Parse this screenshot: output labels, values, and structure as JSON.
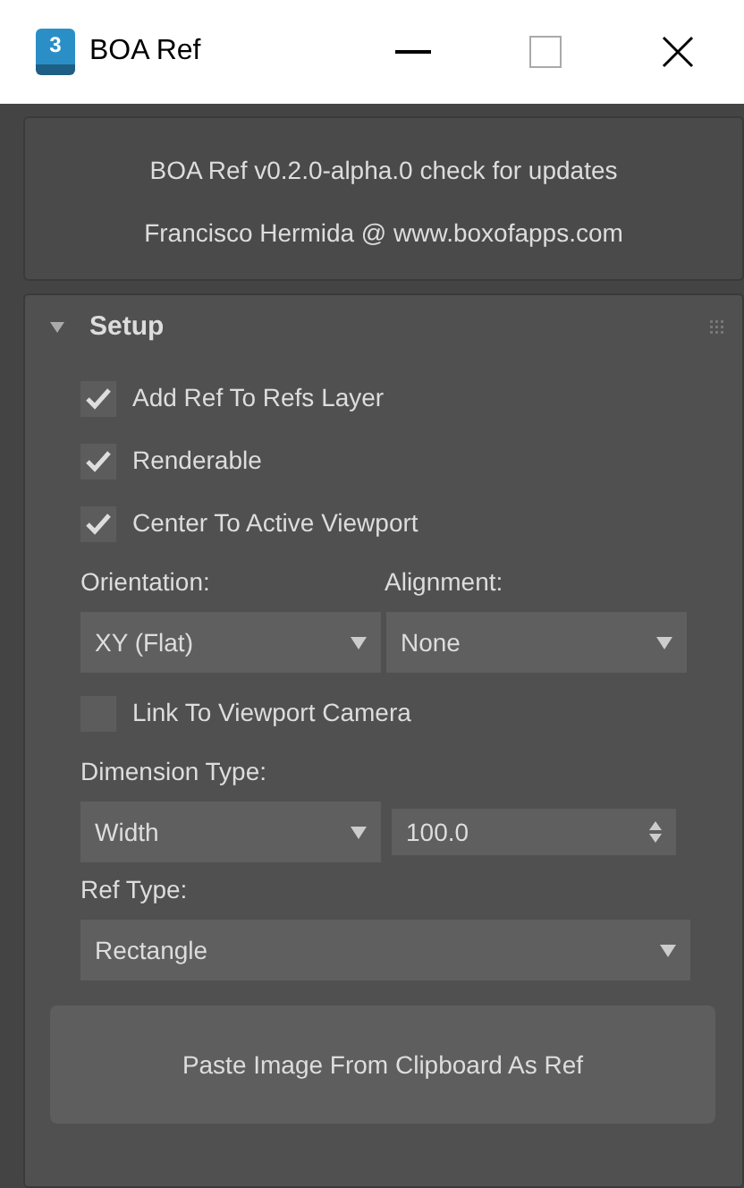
{
  "window": {
    "title": "BOA Ref",
    "app_icon_text": "3"
  },
  "info": {
    "lines": [
      "BOA Ref v0.2.0-alpha.0 check for updates",
      "Francisco Hermida @ www.boxofapps.com"
    ]
  },
  "rollout": {
    "title": "Setup",
    "expanded": true,
    "checkboxes": [
      {
        "label": "Add Ref To Refs Layer",
        "checked": true
      },
      {
        "label": "Renderable",
        "checked": true
      },
      {
        "label": "Center To Active Viewport",
        "checked": true
      }
    ],
    "orientation": {
      "label": "Orientation:",
      "value": "XY (Flat)"
    },
    "alignment": {
      "label": "Alignment:",
      "value": "None"
    },
    "link_camera": {
      "label": "Link To Viewport Camera",
      "checked": false
    },
    "dimension": {
      "label": "Dimension Type:",
      "value": "Width",
      "amount": "100.0"
    },
    "ref_type": {
      "label": "Ref Type:",
      "value": "Rectangle"
    },
    "button": "Paste Image From Clipboard As Ref"
  }
}
